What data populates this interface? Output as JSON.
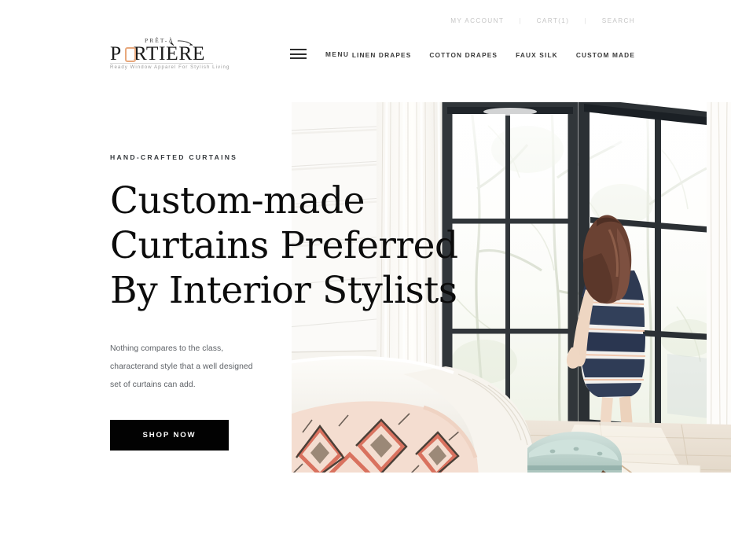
{
  "brand": {
    "pret": "PRÊT-À",
    "name_before_o": "P",
    "name_after_o": "RTIÈRE",
    "tagline": "Ready Window Apparel For Stylish Living",
    "accent_color": "#E8A87C"
  },
  "utility_nav": {
    "account": "MY ACCOUNT",
    "separator": "|",
    "cart": "CART(1)",
    "search": "SEARCH"
  },
  "menu": {
    "label": "MENU",
    "icon": "hamburger-icon"
  },
  "main_nav": {
    "items": [
      {
        "label": "LINEN DRAPES"
      },
      {
        "label": "COTTON DRAPES"
      },
      {
        "label": "FAUX SILK"
      },
      {
        "label": "CUSTOM MADE"
      }
    ]
  },
  "hero": {
    "eyebrow": "HAND-CRAFTED CURTAINS",
    "headline_lines": [
      "Custom-made",
      "Curtains Preferred",
      "By Interior Stylists"
    ],
    "subcopy_lines": [
      "Nothing compares to the class,",
      "characterand style that a well designed set",
      "of curtains can add."
    ],
    "cta_label": "SHOP NOW",
    "cta_bg": "#020202",
    "image_alt": "woman-by-window-photo"
  },
  "theme": {
    "page_bg": "#FFFFFF",
    "text_dark": "#0C0C0C",
    "text_muted": "#5D6166",
    "utility_gray": "#C6C6C6"
  }
}
